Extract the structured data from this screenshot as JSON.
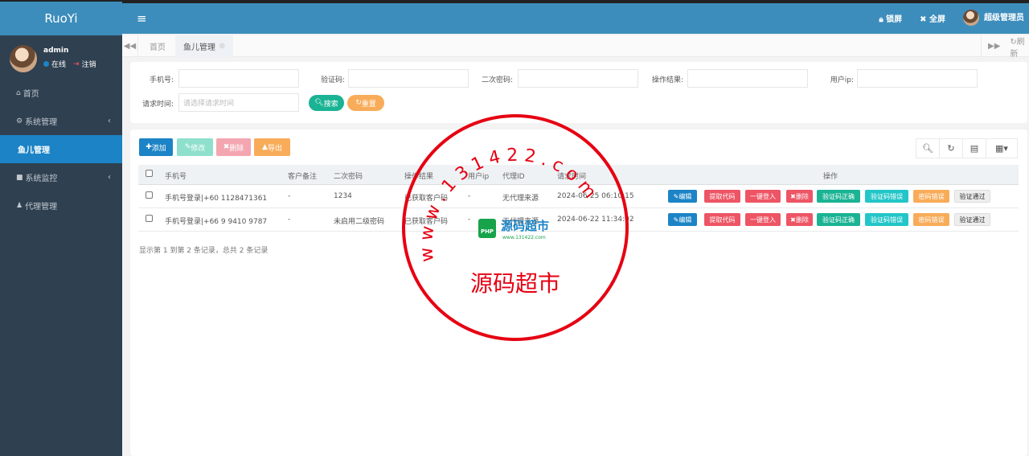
{
  "app": {
    "logo": "RuoYi"
  },
  "user": {
    "name": "admin",
    "status": "在线",
    "logout": "注销"
  },
  "sidebar": {
    "items": [
      {
        "label": "首页",
        "icon": "home-icon"
      },
      {
        "label": "系统管理",
        "icon": "gear-icon"
      },
      {
        "label": "鱼儿管理",
        "icon": ""
      },
      {
        "label": "系统监控",
        "icon": "video-icon"
      },
      {
        "label": "代理管理",
        "icon": "user-icon"
      }
    ]
  },
  "header": {
    "menu_icon": "hamburger-icon",
    "lock": "锁屏",
    "fullscreen": "全屏",
    "admin_name": "超级管理员"
  },
  "tabs": {
    "items": [
      {
        "label": "首页"
      },
      {
        "label": "鱼儿管理"
      }
    ],
    "refresh": "刷新"
  },
  "search": {
    "phone_label": "手机号:",
    "code_label": "验证码:",
    "pwd2_label": "二次密码:",
    "result_label": "操作结果:",
    "ip_label": "用户ip:",
    "time_label": "请求时间:",
    "time_placeholder": "请选择请求时间",
    "search_btn": "搜索",
    "reset_btn": "重置"
  },
  "toolbar": {
    "add": "添加",
    "edit": "修改",
    "delete": "删除",
    "export": "导出"
  },
  "table": {
    "headers": [
      "手机号",
      "客户备注",
      "二次密码",
      "操作结果",
      "用户ip",
      "代理ID",
      "请求时间",
      "操作"
    ],
    "rows": [
      {
        "phone": "手机号登录|+60 1128471361",
        "note": "-",
        "pwd2": "1234",
        "result": "已获取客户码",
        "ip": "-",
        "agent": "无代理来源",
        "time": "2024-06-25 06:10:15"
      },
      {
        "phone": "手机号登录|+66 9 9410 9787",
        "note": "-",
        "pwd2": "未启用二级密码",
        "result": "已获取客户码",
        "ip": "-",
        "agent": "无代理来源",
        "time": "2024-06-22 11:34:02"
      }
    ],
    "ops": [
      "编辑",
      "提取代码",
      "一键登入",
      "删除",
      "验证码正确",
      "验证码错误",
      "密码错误",
      "验证通过"
    ],
    "pager": "显示第 1 到第 2 条记录，总共 2 条记录"
  },
  "stamp": {
    "top_text": "w w w . 1 3 1 4 2 2 . c o m",
    "center": "源码超市",
    "logo": "源码超市",
    "logo_sub": "www.131422.com",
    "php": "PHP"
  },
  "colors": {
    "sidebar": "#2f4050",
    "header": "#3c8dbc",
    "active": "#1c84c6",
    "stamp": "#e60012"
  }
}
